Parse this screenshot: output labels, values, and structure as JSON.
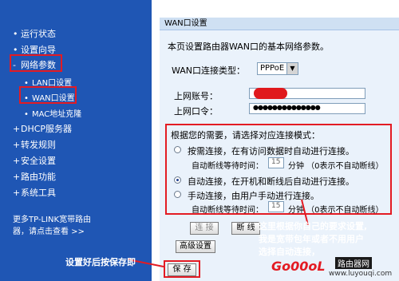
{
  "sidebar": {
    "items": [
      {
        "label": "运行状态",
        "bullet": "•"
      },
      {
        "label": "设置向导",
        "bullet": "•"
      },
      {
        "label": "网络参数",
        "bullet": "-"
      },
      {
        "label": "LAN口设置",
        "bullet": "•"
      },
      {
        "label": "WAN口设置",
        "bullet": "•"
      },
      {
        "label": "MAC地址克隆",
        "bullet": "•"
      },
      {
        "label": "DHCP服务器",
        "bullet": "+"
      },
      {
        "label": "转发规则",
        "bullet": "+"
      },
      {
        "label": "安全设置",
        "bullet": "+"
      },
      {
        "label": "路由功能",
        "bullet": "+"
      },
      {
        "label": "系统工具",
        "bullet": "+"
      }
    ],
    "more_line1": "更多TP-LINK宽带路由",
    "more_line2": "器，请点击查看 >>"
  },
  "panel": {
    "title": "WAN口设置",
    "intro": "本页设置路由器WAN口的基本网络参数。",
    "conn_type_label": "WAN口连接类型：",
    "conn_type_value": "PPPoE",
    "account_label": "上网账号：",
    "password_label": "上网口令：",
    "password_mask": "●●●●●●●●●●●●●●",
    "mode_prompt": "根据您的需要，请选择对应连接模式：",
    "modes": [
      {
        "label": "按需连接，在有访问数据时自动进行连接。",
        "selected": false
      },
      {
        "label": "自动连接，在开机和断线后自动进行连接。",
        "selected": true
      },
      {
        "label": "手动连接，由用户手动进行连接。",
        "selected": false
      }
    ],
    "idle_label": "自动断线等待时间：",
    "idle_value": "15",
    "idle_unit": "分钟 （0表示不自动断线）",
    "connect_label": "连 接",
    "disconnect_label": "断 线",
    "advanced_label": "高级设置",
    "save_label": "保 存"
  },
  "annotations": {
    "note_lines": [
      "这里根据你自己的要求设置,",
      "我是宽带包年或者不用用户",
      "选择自动连接，"
    ],
    "save_hint": "设置好后按保存即",
    "watermark_brand": "Go00oL",
    "watermark_site": "路由器网",
    "watermark_url": "www.luyouqi.com"
  },
  "colors": {
    "sidebar_bg": "#1f56b4",
    "highlight": "#e31b23",
    "panel_bg": "#eaf2fb"
  }
}
